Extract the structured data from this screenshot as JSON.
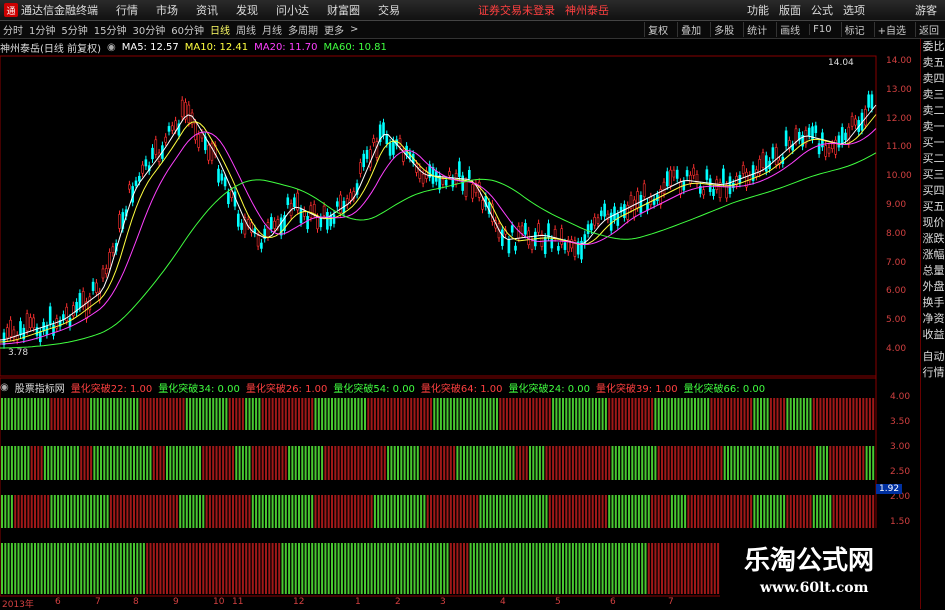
{
  "titlebar": {
    "logo": "通",
    "app_title": "通达信金融终端",
    "menu": [
      "行情",
      "市场",
      "资讯",
      "发现",
      "问小达",
      "财富圈",
      "交易"
    ],
    "notice": "证券交易未登录",
    "stock": "神州泰岳",
    "right": [
      "功能",
      "版面",
      "公式",
      "选项"
    ],
    "guest": "游客"
  },
  "toolbar": {
    "periods": [
      "分时",
      "1分钟",
      "5分钟",
      "15分钟",
      "30分钟",
      "60分钟",
      "日线",
      "周线",
      "月线",
      "多周期",
      "更多"
    ],
    "selected": "日线",
    "right": [
      "复权",
      "叠加",
      "多股",
      "统计",
      "画线",
      "F10",
      "标记",
      "+自选",
      "返回"
    ]
  },
  "ma_bar": {
    "title": "神州泰岳(日线 前复权)",
    "ma5": "MA5: 12.57",
    "ma10": "MA10: 12.41",
    "ma20": "MA20: 11.70",
    "ma60": "MA60: 10.81"
  },
  "indicator_bar": {
    "name": "股票指标网",
    "items": [
      {
        "label": "量化突破22: 1.00",
        "color": "#ff4040"
      },
      {
        "label": "量化突破34: 0.00",
        "color": "#40ff40"
      },
      {
        "label": "量化突破26: 1.00",
        "color": "#ff4040"
      },
      {
        "label": "量化突破54: 0.00",
        "color": "#40ff40"
      },
      {
        "label": "量化突破64: 1.00",
        "color": "#ff4040"
      },
      {
        "label": "量化突破24: 0.00",
        "color": "#40ff40"
      },
      {
        "label": "量化突破39: 1.00",
        "color": "#ff4040"
      },
      {
        "label": "量化突破66: 0.00",
        "color": "#40ff40"
      }
    ]
  },
  "price_axis": [
    "14.00",
    "13.00",
    "12.00",
    "11.00",
    "10.00",
    "9.00",
    "8.00",
    "7.00",
    "6.00",
    "5.00",
    "4.00"
  ],
  "ind_axis": [
    "4.00",
    "3.50",
    "3.00",
    "2.50",
    "2.00",
    "1.50"
  ],
  "ind_value": "1.92",
  "max_label": "14.04",
  "min_label": "3.78",
  "dates": [
    "2013年",
    "6",
    "7",
    "8",
    "9",
    "10",
    "11",
    "12",
    "1",
    "2",
    "3",
    "4",
    "5",
    "6",
    "7"
  ],
  "right_panel": [
    "委比",
    "卖五",
    "卖四",
    "卖三",
    "卖二",
    "卖一",
    "买一",
    "买二",
    "买三",
    "买四",
    "买五",
    "现价",
    "涨跌",
    "涨幅",
    "总量",
    "外盘",
    "换手",
    "净资",
    "收益",
    "自动",
    "行情"
  ],
  "watermark": {
    "line1": "乐淘公式网",
    "line2": "www.60lt.com"
  },
  "colors": {
    "up": "#ff3030",
    "down": "#00ffff",
    "ma5": "#ffffff",
    "ma10": "#ffff40",
    "ma20": "#ff40ff",
    "ma60": "#40ff40",
    "bar_red": "#a01818",
    "bar_green": "#48c830"
  }
}
